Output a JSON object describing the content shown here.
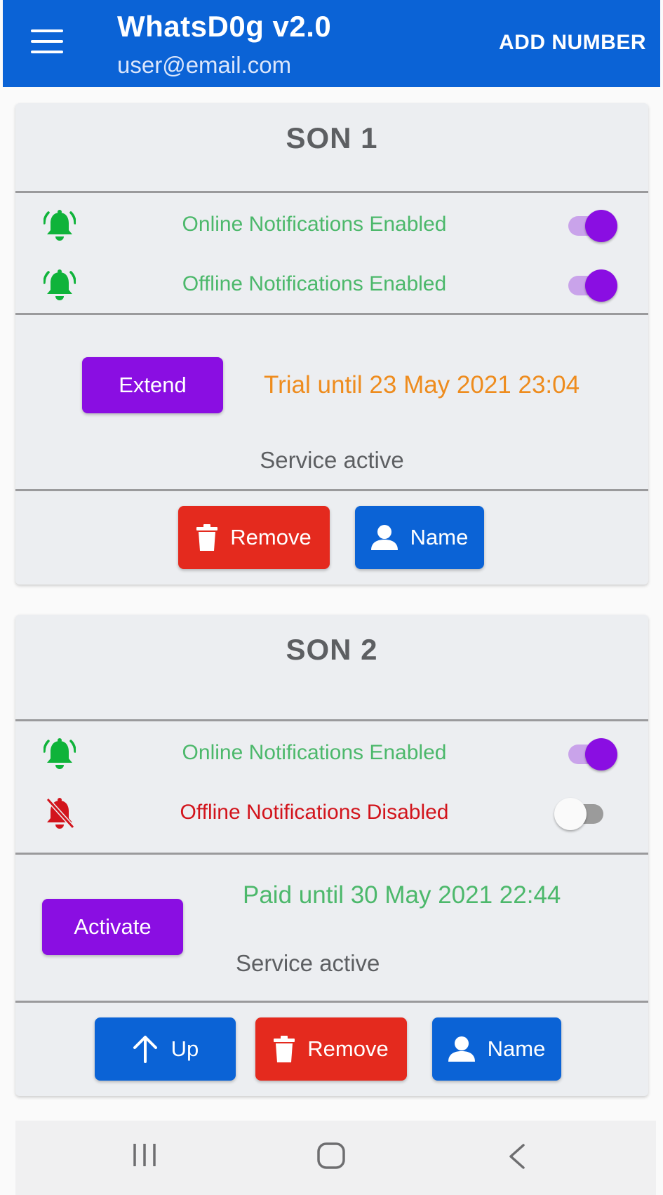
{
  "appbar": {
    "title": "WhatsD0g v2.0",
    "subtitle": "user@email.com",
    "add_number_label": "ADD NUMBER"
  },
  "cards": [
    {
      "title": "SON 1",
      "notifications": [
        {
          "label": "Online Notifications Enabled",
          "enabled": true,
          "icon": "bell-ringing-icon"
        },
        {
          "label": "Offline Notifications Enabled",
          "enabled": true,
          "icon": "bell-ringing-icon"
        }
      ],
      "action_label": "Extend",
      "status_until": "Trial until 23 May 2021 23:04",
      "service_status": "Service active",
      "remove_label": "Remove",
      "name_label": "Name"
    },
    {
      "title": "SON 2",
      "notifications": [
        {
          "label": "Online Notifications Enabled",
          "enabled": true,
          "icon": "bell-ringing-icon"
        },
        {
          "label": "Offline Notifications Disabled",
          "enabled": false,
          "icon": "bell-off-icon"
        }
      ],
      "action_label": "Activate",
      "status_until": "Paid until 30 May 2021 22:44",
      "service_status": "Service active",
      "up_label": "Up",
      "remove_label": "Remove",
      "name_label": "Name"
    }
  ],
  "colors": {
    "primary_blue": "#0b63d6",
    "accent_purple": "#8a0ee2",
    "danger_red": "#e42a1e",
    "enabled_green": "#4cb86b",
    "disabled_red": "#d2141c",
    "trial_orange": "#ee8c1e",
    "card_bg": "#eceef1"
  },
  "navbar": {
    "icons": [
      "recent-apps-icon",
      "home-icon",
      "back-icon"
    ]
  }
}
